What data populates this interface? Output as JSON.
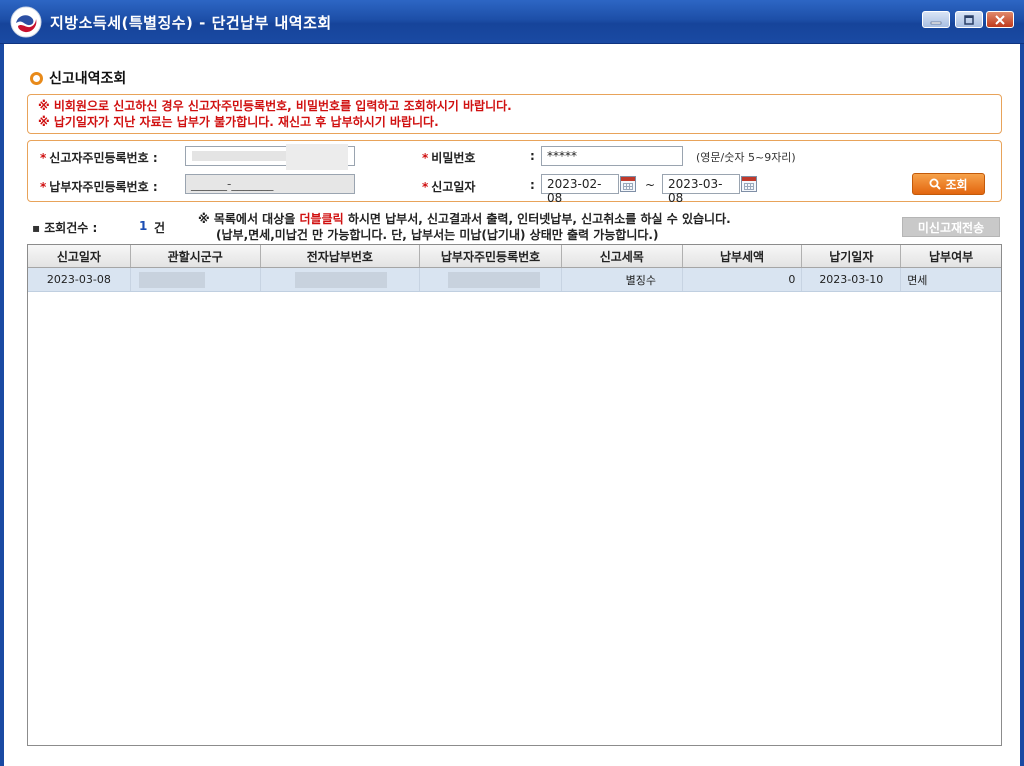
{
  "window": {
    "title": "지방소득세(특별징수) - 단건납부 내역조회"
  },
  "section": {
    "title": "신고내역조회"
  },
  "notices": [
    "※ 비회원으로 신고하신 경우 신고자주민등록번호, 비밀번호를 입력하고 조회하시기 바랍니다.",
    "※ 납기일자가 지난 자료는 납부가 불가합니다. 재신고 후 납부하시기 바랍니다."
  ],
  "search": {
    "reporter_id_label": "신고자주민등록번호 :",
    "payer_id_label": "납부자주민등록번호 :",
    "payer_id_value": "______-_______",
    "password_label": "비밀번호",
    "password_value": "*****",
    "password_hint": "(영문/숫자 5~9자리)",
    "report_date_label": "신고일자",
    "colon": ":",
    "date_from": "2023-02-08",
    "date_sep": "~",
    "date_to": "2023-03-08",
    "search_button": "조회"
  },
  "result": {
    "count_label": "조회건수 :",
    "count_value": "1",
    "count_unit": "건",
    "guide_line1_a": "※ 목록에서 대상을 ",
    "guide_line1_red": "더블클릭",
    "guide_line1_b": " 하시면 납부서, 신고결과서 출력, 인터넷납부, 신고취소를 하실 수 있습니다.",
    "guide_line2": "(납부,면세,미납건 만 가능합니다. 단, 납부서는 미납(납기내) 상태만 출력 가능합니다.)",
    "resend_button": "미신고재전송"
  },
  "table": {
    "headers": [
      "신고일자",
      "관할시군구",
      "전자납부번호",
      "납부자주민등록번호",
      "신고세목",
      "납부세액",
      "납기일자",
      "납부여부"
    ],
    "rows": [
      {
        "report_date": "2023-03-08",
        "district": "",
        "e_payment_no": "",
        "payer_id": "",
        "tax_item": "별징수",
        "amount": "0",
        "due_date": "2023-03-10",
        "status": "면세"
      }
    ]
  },
  "colors": {
    "titlebar": "#1d4fa8",
    "accent": "#e88a1a",
    "warning": "#d01010",
    "count": "#1b4db3",
    "row_selected": "#d9e4f1"
  },
  "icons": [
    "app-logo-icon",
    "minimize-icon",
    "maximize-icon",
    "close-icon",
    "calendar-icon",
    "search-icon"
  ]
}
